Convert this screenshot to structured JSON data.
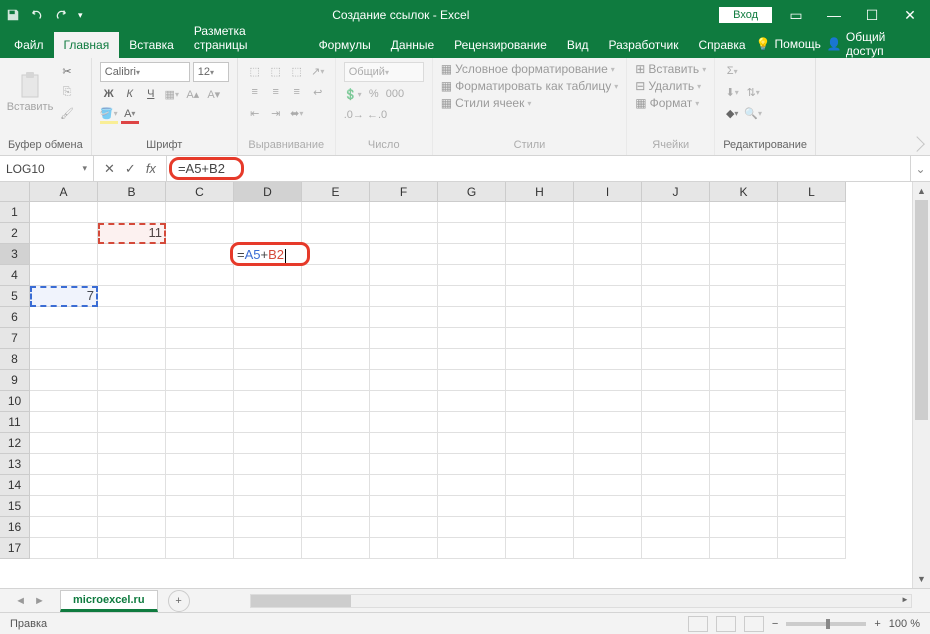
{
  "titlebar": {
    "title": "Создание ссылок - Excel",
    "login": "Вход"
  },
  "tabs": {
    "file": "Файл",
    "home": "Главная",
    "insert": "Вставка",
    "layout": "Разметка страницы",
    "formulas": "Формулы",
    "data": "Данные",
    "review": "Рецензирование",
    "view": "Вид",
    "developer": "Разработчик",
    "help": "Справка",
    "help_menu": "Помощь",
    "share": "Общий доступ"
  },
  "ribbon": {
    "clipboard": {
      "label": "Буфер обмена",
      "paste": "Вставить"
    },
    "font": {
      "label": "Шрифт",
      "name": "Calibri",
      "size": "12"
    },
    "alignment": {
      "label": "Выравнивание"
    },
    "number": {
      "label": "Число",
      "format": "Общий"
    },
    "styles": {
      "label": "Стили",
      "conditional": "Условное форматирование",
      "table": "Форматировать как таблицу",
      "cell": "Стили ячеек"
    },
    "cells": {
      "label": "Ячейки",
      "insert": "Вставить",
      "delete": "Удалить",
      "format": "Формат"
    },
    "editing": {
      "label": "Редактирование"
    }
  },
  "formula_bar": {
    "name_box": "LOG10",
    "formula": "=A5+B2"
  },
  "grid": {
    "columns": [
      "A",
      "B",
      "C",
      "D",
      "E",
      "F",
      "G",
      "H",
      "I",
      "J",
      "K",
      "L"
    ],
    "rows": [
      "1",
      "2",
      "3",
      "4",
      "5",
      "6",
      "7",
      "8",
      "9",
      "10",
      "11",
      "12",
      "13",
      "14",
      "15",
      "16",
      "17"
    ],
    "b2": "11",
    "a5": "7",
    "d3_prefix": "=",
    "d3_a5": "A5",
    "d3_plus": "+",
    "d3_b2": "B2"
  },
  "sheets": {
    "tab1": "microexcel.ru"
  },
  "status": {
    "mode": "Правка",
    "zoom": "100 %"
  }
}
